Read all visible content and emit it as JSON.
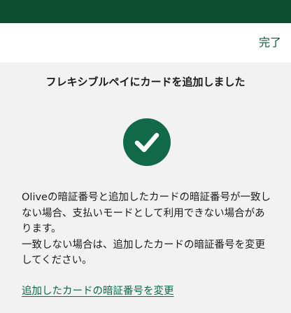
{
  "header": {
    "done_label": "完了"
  },
  "main": {
    "title": "フレキシブルペイにカードを追加しました",
    "status_icon": "check-circle-icon",
    "message_lines": [
      "Oliveの暗証番号と追加したカードの暗証番号が一致しない場合、支払いモードとして利用できない場合があります。",
      "一致しない場合は、追加したカードの暗証番号を変更してください。"
    ],
    "change_pin_link": "追加したカードの暗証番号を変更"
  },
  "colors": {
    "top_bar": "#0c4d31",
    "accent": "#11694a",
    "link": "#0c6b47",
    "background": "#f2f2f2"
  }
}
